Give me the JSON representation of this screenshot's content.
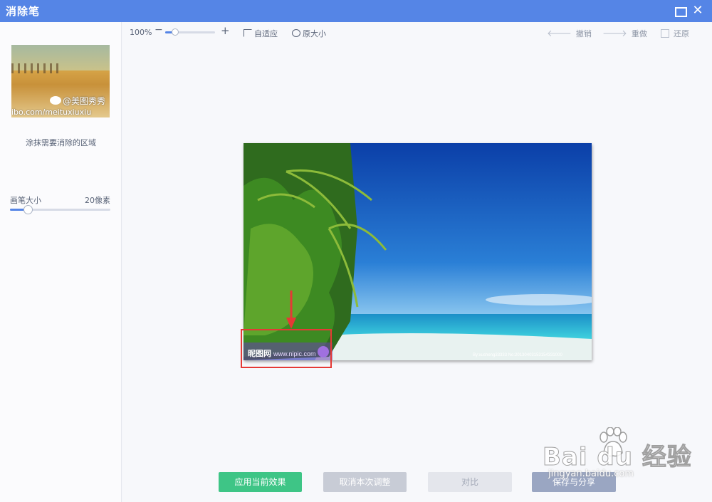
{
  "window": {
    "title": "消除笔",
    "maximize_icon": "maximize-icon",
    "close_icon": "close-icon",
    "close_glyph": "✕"
  },
  "sidebar": {
    "thumbnail": {
      "watermark_handle": "@美图秀秀",
      "watermark_url": "ibo.com/meituxiuxiu"
    },
    "hint": "涂抹需要消除的区域",
    "brush": {
      "label": "画笔大小",
      "value": "20像素",
      "level": 0.18
    }
  },
  "toolbar": {
    "zoom_percent": "100%",
    "zoom_minus": "−",
    "zoom_plus": "+",
    "zoom_level": 0.2,
    "fit": "自适应",
    "original": "原大小",
    "undo": "撤销",
    "redo": "重做",
    "restore": "还原"
  },
  "canvas": {
    "photo_watermark_left": "昵图网",
    "photo_watermark_url": "www.nipic.com",
    "photo_watermark_right": "By:xusheng33333 No:20130403153154331000"
  },
  "actions": {
    "apply": "应用当前效果",
    "cancel": "取消本次调整",
    "compare": "对比",
    "save": "保存与分享"
  },
  "overlay": {
    "brand": "Bai du 经验",
    "url": "jingyan.baidu.com"
  },
  "colors": {
    "title_bar": "#5585e6",
    "apply_button": "#3ec586",
    "highlight_box": "#e53935"
  }
}
